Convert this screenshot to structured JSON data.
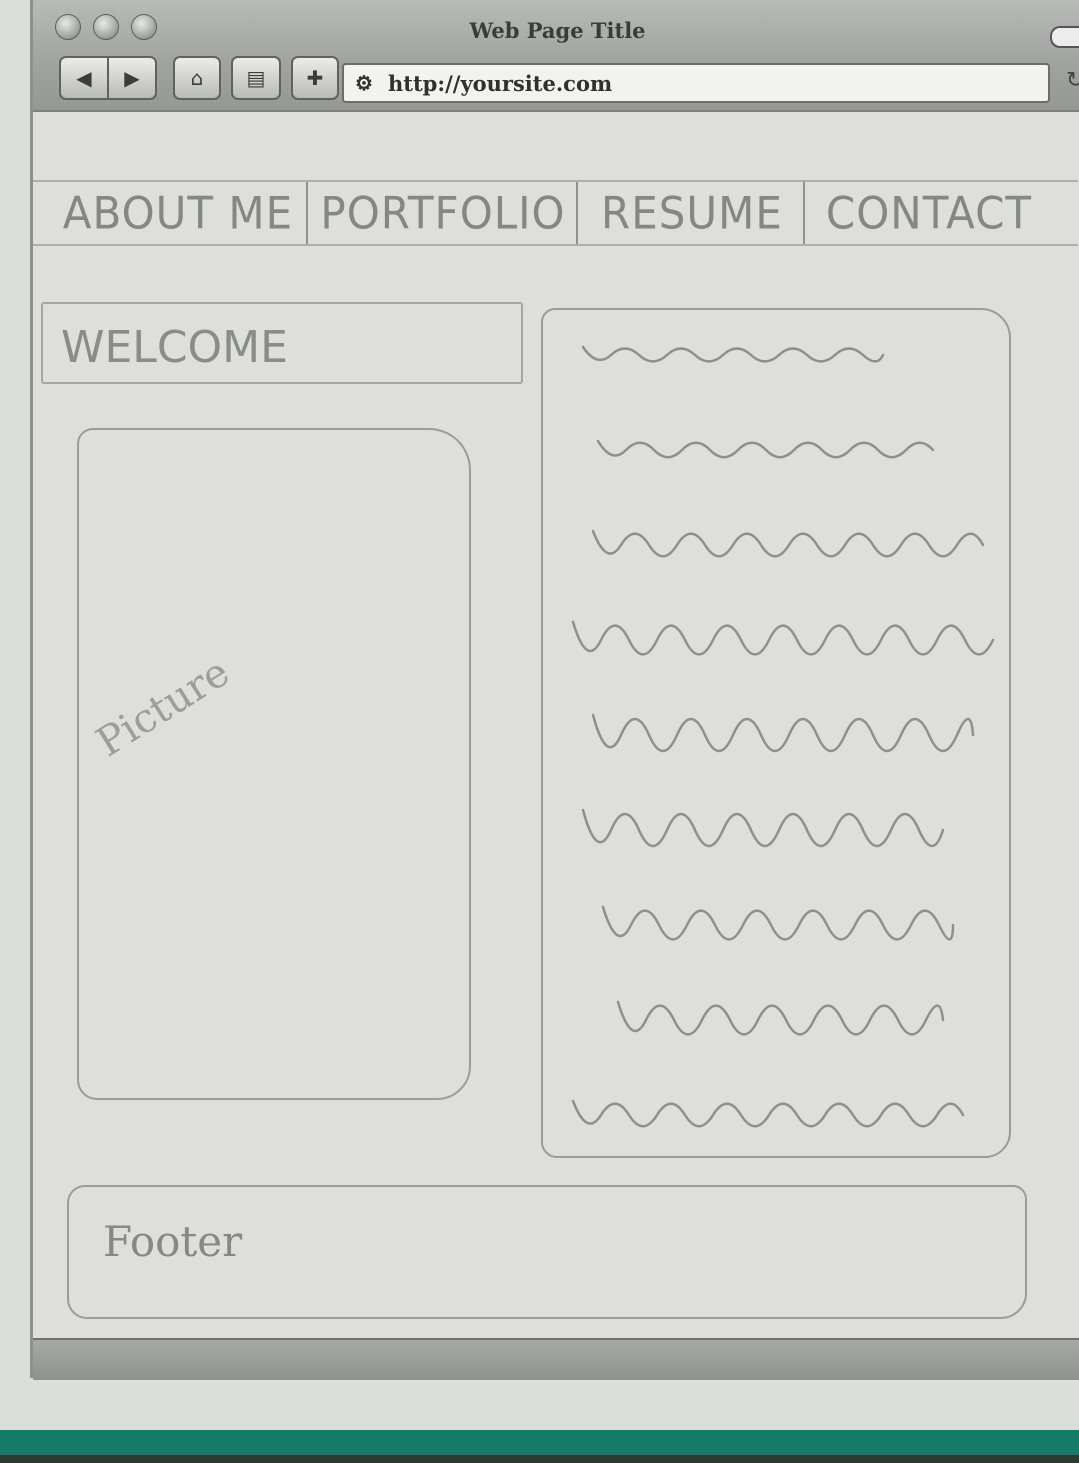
{
  "browser": {
    "window_title": "Web Page Title",
    "url": "http://yoursite.com",
    "toolbar_icons": [
      "back-icon",
      "forward-icon",
      "home-icon",
      "print-icon",
      "add-tab-icon",
      "site-icon",
      "reload-icon"
    ],
    "glyphs": {
      "back": "◀",
      "forward": "▶",
      "home": "⌂",
      "print": "▤",
      "add": "✚",
      "site": "⚙",
      "reload": "↻"
    }
  },
  "nav": {
    "items": [
      {
        "label": "ABOUT ME"
      },
      {
        "label": "PORTFOLIO"
      },
      {
        "label": "RESUME"
      },
      {
        "label": "CONTACT"
      }
    ]
  },
  "main": {
    "welcome": "WELCOME",
    "picture_label": "Picture",
    "text_lines": 9
  },
  "footer": {
    "label": "Footer"
  }
}
